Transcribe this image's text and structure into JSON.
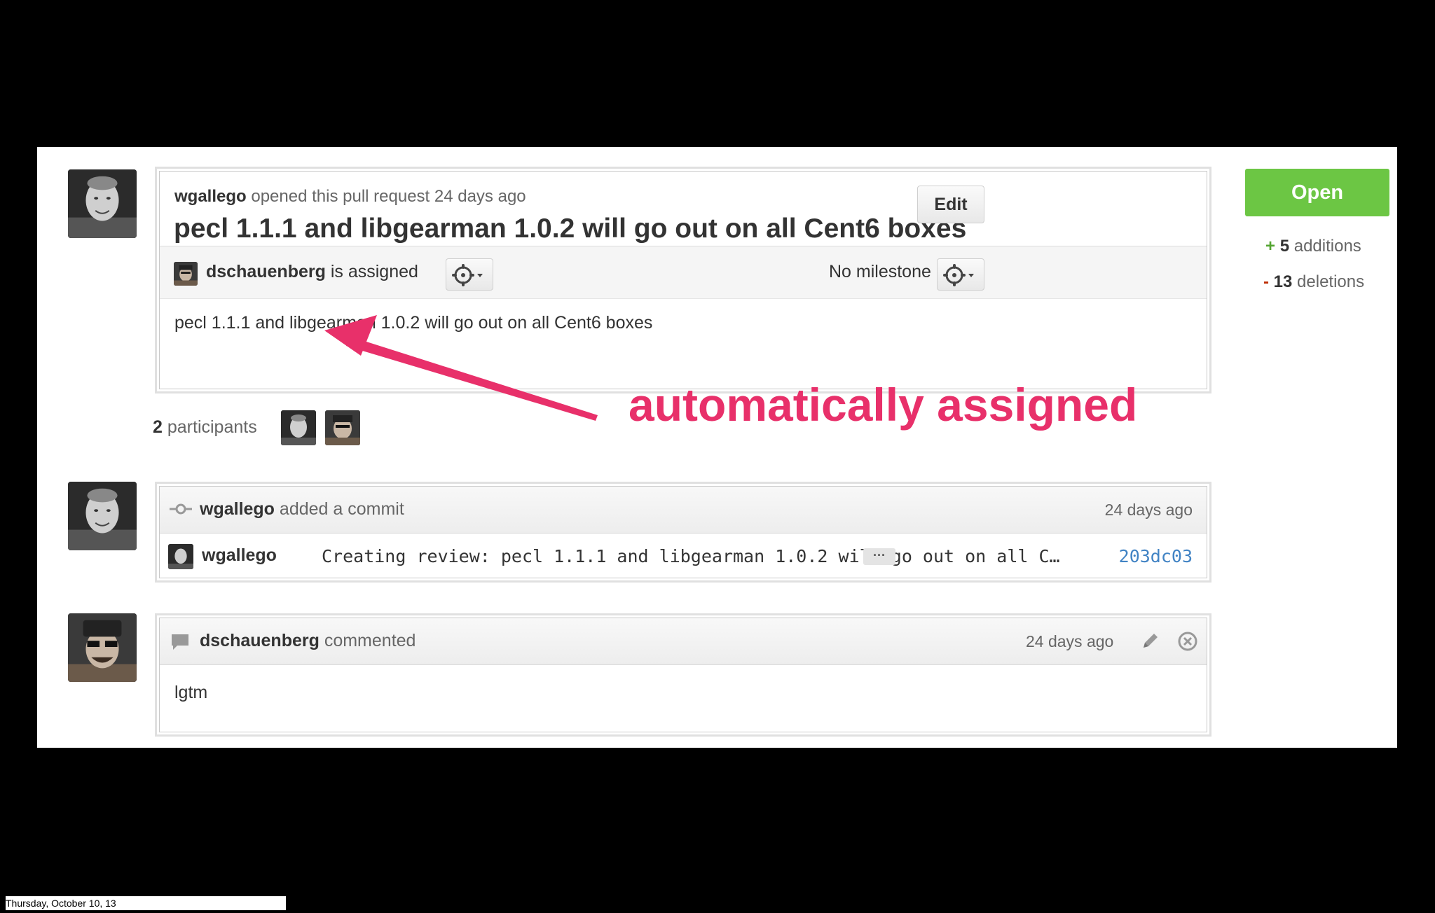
{
  "header": {
    "author": "wgallego",
    "opened_text": "opened this pull request 24 days ago",
    "title": "pecl 1.1.1 and libgearman 1.0.2 will go out on all Cent6 boxes",
    "edit_label": "Edit"
  },
  "assignee": {
    "name": "dschauenberg",
    "text": "is assigned"
  },
  "milestone": {
    "label": "No milestone"
  },
  "body_text": "pecl 1.1.1 and libgearman 1.0.2 will go out on all Cent6 boxes",
  "participants": {
    "count": "2",
    "label": "participants"
  },
  "status": {
    "state": "Open",
    "additions_sign": "+",
    "additions_count": "5",
    "additions_label": "additions",
    "deletions_sign": "-",
    "deletions_count": "13",
    "deletions_label": "deletions"
  },
  "annotation": "automatically assigned",
  "commit_event": {
    "author": "wgallego",
    "action": "added a commit",
    "time": "24 days ago",
    "commit_author": "wgallego",
    "message": "Creating review: pecl 1.1.1 and libgearman 1.0.2 will go out on all C…",
    "ellipsis": "···",
    "sha": "203dc03"
  },
  "comment_event": {
    "author": "dschauenberg",
    "action": "commented",
    "time": "24 days ago",
    "body": "lgtm"
  },
  "footer": {
    "date": "Thursday, October 10, 13"
  },
  "colors": {
    "open_green": "#6cc644",
    "annotation_pink": "#e8306a",
    "sha_blue": "#4183c4"
  }
}
